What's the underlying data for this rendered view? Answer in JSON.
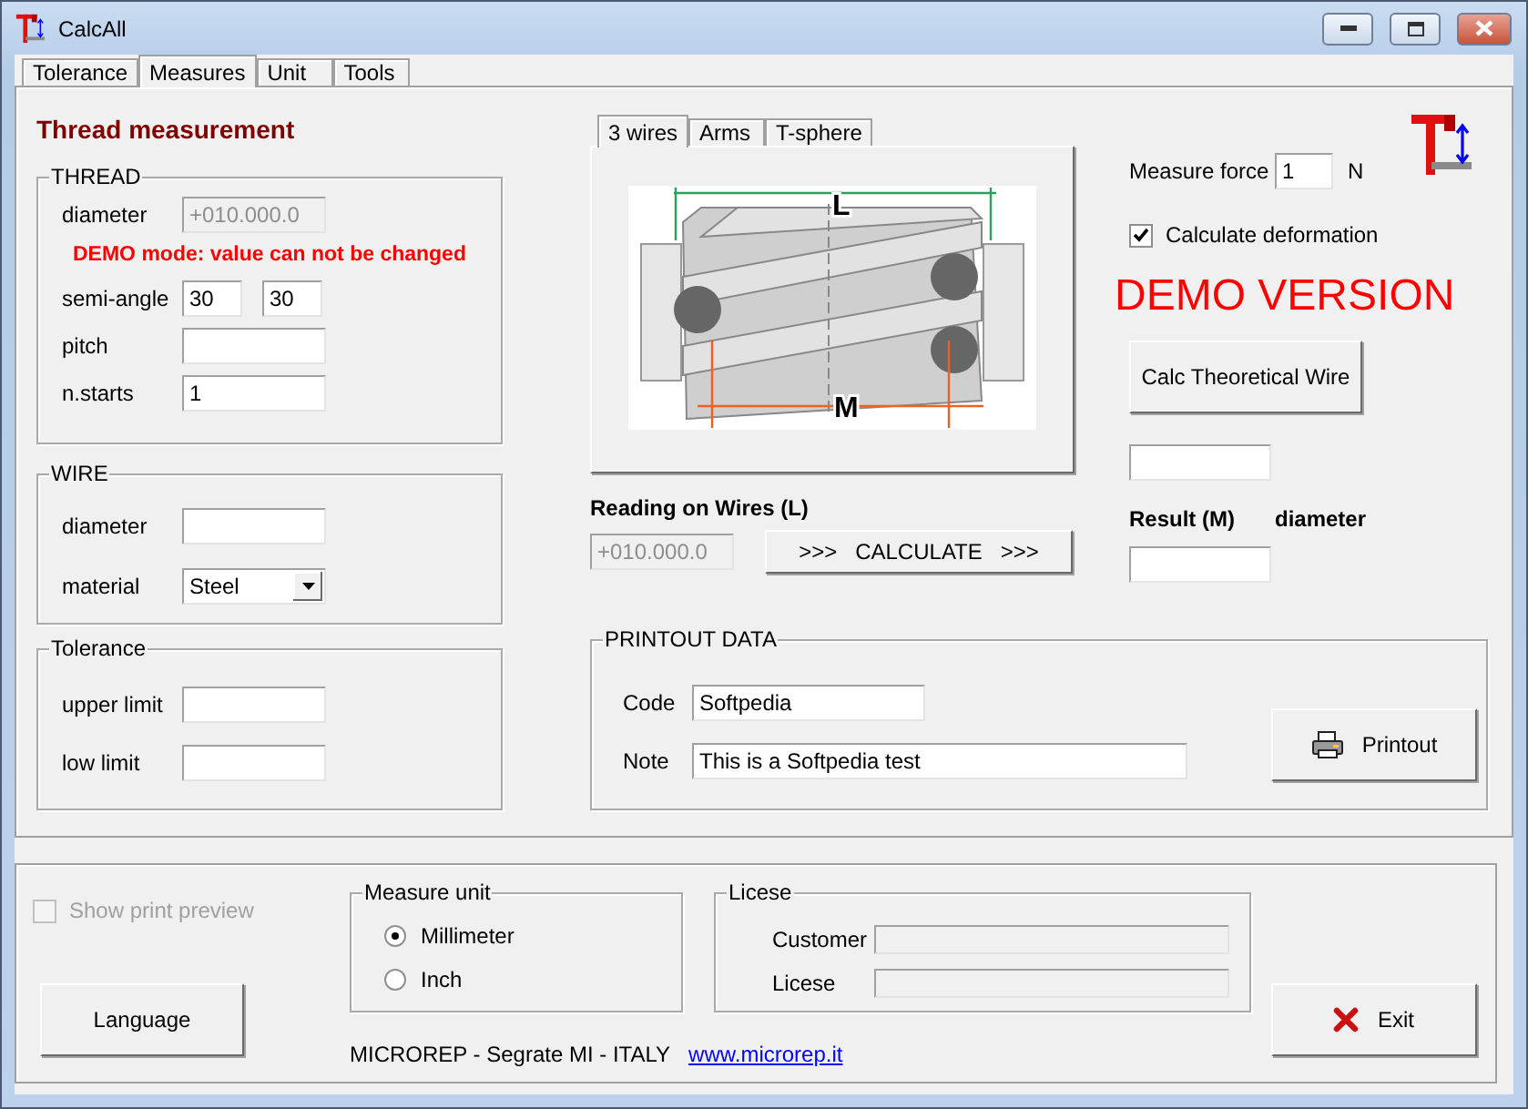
{
  "window": {
    "title": "CalcAll"
  },
  "tabs": [
    {
      "label": "Tolerance",
      "selected": false
    },
    {
      "label": "Measures",
      "selected": true
    },
    {
      "label": "Unit",
      "selected": false
    },
    {
      "label": "Tools",
      "selected": false
    }
  ],
  "heading": "Thread measurement",
  "thread": {
    "title": "THREAD",
    "rows": [
      {
        "kind": "field",
        "label": "diameter",
        "inputs": [
          {
            "value": "+010.000.0",
            "disabled": true
          }
        ]
      },
      {
        "kind": "notice",
        "text": "DEMO mode: value can not be changed"
      },
      {
        "kind": "field",
        "label": "semi-angle",
        "inputs": [
          {
            "value": "30",
            "disabled": false
          },
          {
            "value": "30",
            "disabled": false
          }
        ]
      },
      {
        "kind": "field",
        "label": "pitch",
        "inputs": [
          {
            "disabled": false
          }
        ]
      },
      {
        "kind": "field",
        "label": "n.starts",
        "inputs": [
          {
            "value": "1",
            "disabled": false
          }
        ]
      }
    ]
  },
  "wire": {
    "title": "WIRE",
    "rows": [
      {
        "kind": "field",
        "label": "diameter",
        "inputs": [
          {
            "disabled": false
          }
        ]
      },
      {
        "kind": "select",
        "label": "material",
        "value": "Steel"
      }
    ]
  },
  "tolerance": {
    "title": "Tolerance",
    "rows": [
      {
        "kind": "field",
        "label": "upper limit",
        "inputs": [
          {
            "disabled": false
          }
        ]
      },
      {
        "kind": "field",
        "label": "low limit",
        "inputs": [
          {
            "disabled": false
          }
        ]
      }
    ]
  },
  "method_tabs": [
    {
      "label": "3 wires",
      "selected": true
    },
    {
      "label": "Arms",
      "selected": false
    },
    {
      "label": "T-sphere",
      "selected": false
    }
  ],
  "diagram": {
    "labels": [
      "L",
      "M"
    ]
  },
  "reading": {
    "label": "Reading on Wires (L)",
    "value": "+010.000.0",
    "disabled": true
  },
  "calculate_button": ">>>   CALCULATE   >>>",
  "measure_force": {
    "label": "Measure force",
    "value": "1",
    "unit": "N"
  },
  "calculate_deformation": {
    "label": "Calculate deformation",
    "checked": true
  },
  "demo_banner": "DEMO VERSION",
  "calc_wire_button": "Calc Theoretical Wire",
  "wire_result": {
    "disabled": false
  },
  "result": {
    "label": "Result (M)",
    "sublabel": "diameter",
    "disabled": false
  },
  "printout": {
    "title": "PRINTOUT DATA",
    "rows": [
      {
        "label": "Code",
        "value": "Softpedia"
      },
      {
        "label": "Note",
        "value": "This is a Softpedia test"
      }
    ],
    "button": "Printout"
  },
  "show_print_preview": {
    "label": "Show print preview",
    "checked": false,
    "disabled": true
  },
  "language_button": "Language",
  "measure_unit": {
    "title": "Measure unit",
    "options": [
      {
        "label": "Millimeter",
        "selected": true
      },
      {
        "label": "Inch",
        "selected": false
      }
    ]
  },
  "licence": {
    "title": "Licese",
    "rows": [
      {
        "label": "Customer",
        "disabled": true
      },
      {
        "label": "Licese",
        "disabled": true
      }
    ]
  },
  "footer": {
    "company": "MICROREP - Segrate MI - ITALY",
    "link": "www.microrep.it"
  },
  "exit_button": "Exit"
}
